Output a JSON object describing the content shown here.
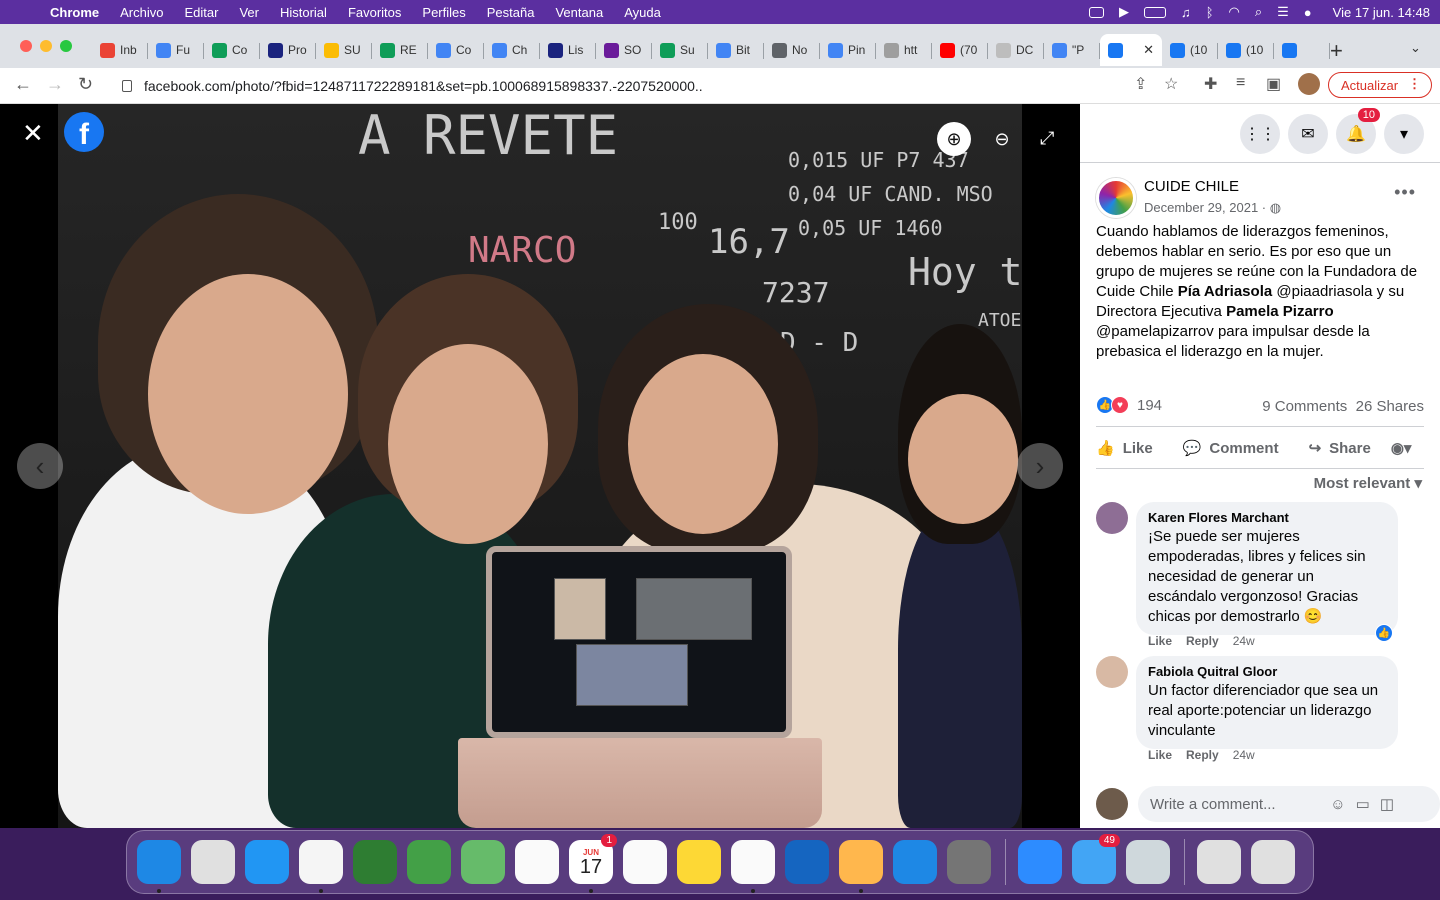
{
  "menubar": {
    "app_name": "Chrome",
    "items": [
      "Archivo",
      "Editar",
      "Ver",
      "Historial",
      "Favoritos",
      "Perfiles",
      "Pestaña",
      "Ventana",
      "Ayuda"
    ],
    "clock": "Vie 17 jun.  14:48"
  },
  "tabs": [
    {
      "label": "Inb",
      "icon": "gmail-icon",
      "color": "#ea4335"
    },
    {
      "label": "Fu",
      "icon": "docs-icon",
      "color": "#4285f4"
    },
    {
      "label": "Co",
      "icon": "sheets-icon",
      "color": "#0f9d58"
    },
    {
      "label": "Pro",
      "icon": "circle-icon",
      "color": "#1a237e"
    },
    {
      "label": "SU",
      "icon": "drive-icon",
      "color": "#fbbc04"
    },
    {
      "label": "RE",
      "icon": "sheets-icon",
      "color": "#0f9d58"
    },
    {
      "label": "Co",
      "icon": "docs-icon",
      "color": "#4285f4"
    },
    {
      "label": "Ch",
      "icon": "docs-icon",
      "color": "#4285f4"
    },
    {
      "label": "Lis",
      "icon": "star-icon",
      "color": "#1a237e"
    },
    {
      "label": "SO",
      "icon": "logo-icon",
      "color": "#6a1b9a"
    },
    {
      "label": "Su",
      "icon": "sheets-icon",
      "color": "#0f9d58"
    },
    {
      "label": "Bit",
      "icon": "docs-icon",
      "color": "#4285f4"
    },
    {
      "label": "No",
      "icon": "search-icon",
      "color": "#5f6368"
    },
    {
      "label": "Pin",
      "icon": "google-icon",
      "color": "#4285f4"
    },
    {
      "label": "htt",
      "icon": "image-icon",
      "color": "#9e9e9e"
    },
    {
      "label": "(70",
      "icon": "youtube-icon",
      "color": "#ff0000"
    },
    {
      "label": "DC",
      "icon": "flower-icon",
      "color": "#bdbdbd"
    },
    {
      "label": "\"P",
      "icon": "google-icon",
      "color": "#4285f4"
    },
    {
      "label": "",
      "icon": "facebook-icon",
      "color": "#1877f2",
      "active": true
    },
    {
      "label": "(10",
      "icon": "facebook-icon",
      "color": "#1877f2"
    },
    {
      "label": "(10",
      "icon": "facebook-icon",
      "color": "#1877f2"
    },
    {
      "label": "",
      "icon": "facebook-icon",
      "color": "#1877f2"
    }
  ],
  "toolbar": {
    "url": "facebook.com/photo/?fbid=1248711722289181&set=pb.100068915898337.-2207520000..",
    "update_label": "Actualizar"
  },
  "photo": {
    "chalk": [
      "A REVETE",
      "0,015 UF P7 437",
      "0,04 UF CAND. MSO",
      "0,05 UF 1460",
      "NARCO",
      "100",
      "16,7",
      "Hoy te",
      "7237",
      "ATOE",
      "D - D"
    ]
  },
  "header": {
    "notifications": "10"
  },
  "post": {
    "page_name": "CUIDE CHILE",
    "date": "December 29, 2021 ·",
    "text_parts": [
      {
        "t": "Cuando hablamos de liderazgos femeninos, debemos hablar en serio. Es por eso que un grupo de mujeres se reúne con la Fundadora de Cuide Chile ",
        "b": false
      },
      {
        "t": "Pía Adriasola",
        "b": true
      },
      {
        "t": " @piaadriasola y su Directora Ejecutiva ",
        "b": false
      },
      {
        "t": "Pamela Pizarro",
        "b": true
      },
      {
        "t": " @pamelapizarrov para impulsar desde la prebasica el liderazgo en la mujer.",
        "b": false
      }
    ],
    "reactions_count": "194",
    "comments_count": "9 Comments",
    "shares_count": "26 Shares",
    "like_label": "Like",
    "comment_label": "Comment",
    "share_label": "Share",
    "sort_label": "Most relevant"
  },
  "comments": [
    {
      "author": "Karen Flores Marchant",
      "text": "¡Se puede ser mujeres empoderadas, libres y felices sin necesidad de generar un escándalo vergonzoso! Gracias chicas por demostrarlo 😊",
      "like": "Like",
      "reply": "Reply",
      "time": "24w"
    },
    {
      "author": "Fabiola Quitral Gloor",
      "text": "Un factor diferenciador que sea un real aporte:potenciar un liderazgo vinculante",
      "like": "Like",
      "reply": "Reply",
      "time": "24w"
    }
  ],
  "write_comment": {
    "placeholder": "Write a comment..."
  },
  "dock": [
    {
      "name": "finder",
      "color": "#1e88e5",
      "dot": true
    },
    {
      "name": "launchpad",
      "color": "#e0e0e0"
    },
    {
      "name": "safari",
      "color": "#2196f3"
    },
    {
      "name": "chrome",
      "color": "#f5f5f5",
      "dot": true
    },
    {
      "name": "facetime",
      "color": "#2e7d32"
    },
    {
      "name": "messages",
      "color": "#43a047"
    },
    {
      "name": "maps",
      "color": "#66bb6a"
    },
    {
      "name": "photos",
      "color": "#fafafa"
    },
    {
      "name": "calendar",
      "color": "#ffffff",
      "badge": "1",
      "month": "JUN",
      "day": "17",
      "dot": true
    },
    {
      "name": "reminders",
      "color": "#fafafa"
    },
    {
      "name": "notes",
      "color": "#fdd835"
    },
    {
      "name": "numbers",
      "color": "#fafafa",
      "dot": true
    },
    {
      "name": "keynote",
      "color": "#1565c0"
    },
    {
      "name": "pages",
      "color": "#ffb74d",
      "dot": true
    },
    {
      "name": "app-store",
      "color": "#1e88e5"
    },
    {
      "name": "system-preferences",
      "color": "#757575"
    },
    {
      "sep": true
    },
    {
      "name": "zoom",
      "color": "#2d8cff"
    },
    {
      "name": "mail",
      "color": "#42a5f5",
      "badge": "49"
    },
    {
      "name": "preview",
      "color": "#cfd8dc"
    },
    {
      "sep": true
    },
    {
      "name": "documents",
      "color": "#e0e0e0"
    },
    {
      "name": "trash",
      "color": "#e0e0e0"
    }
  ]
}
